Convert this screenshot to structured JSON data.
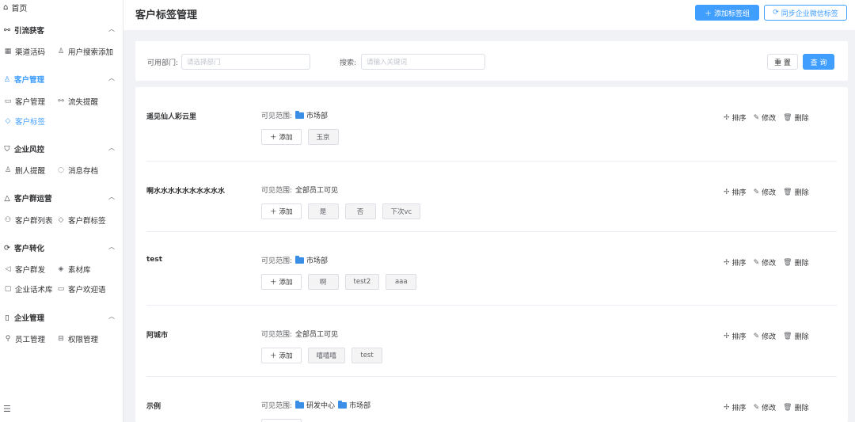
{
  "sidebar": {
    "home": {
      "icon": "home-icon",
      "label": "首页"
    },
    "groups": [
      {
        "icon": "share-icon",
        "title": "引流获客",
        "items": [
          {
            "icon": "qrcode-icon",
            "label": "渠道活码"
          },
          {
            "icon": "user-search-icon",
            "label": "用户搜索添加"
          }
        ]
      },
      {
        "icon": "user-icon",
        "title": "客户管理",
        "active": true,
        "items": [
          {
            "icon": "id-card-icon",
            "label": "客户管理"
          },
          {
            "icon": "user-lost-icon",
            "label": "流失提醒"
          },
          {
            "icon": "tag-icon",
            "label": "客户标签",
            "active": true
          }
        ]
      },
      {
        "icon": "shield-icon",
        "title": "企业风控",
        "items": [
          {
            "icon": "user-delete-icon",
            "label": "删人提醒"
          },
          {
            "icon": "message-icon",
            "label": "消息存档"
          }
        ]
      },
      {
        "icon": "group-icon",
        "title": "客户群运营",
        "items": [
          {
            "icon": "group-list-icon",
            "label": "客户群列表"
          },
          {
            "icon": "tag-icon",
            "label": "客户群标签"
          }
        ]
      },
      {
        "icon": "convert-icon",
        "title": "客户转化",
        "items": [
          {
            "icon": "send-icon",
            "label": "客户群发"
          },
          {
            "icon": "layers-icon",
            "label": "素材库"
          },
          {
            "icon": "chat-icon",
            "label": "企业话术库"
          },
          {
            "icon": "welcome-icon",
            "label": "客户欢迎语"
          }
        ]
      },
      {
        "icon": "building-icon",
        "title": "企业管理",
        "items": [
          {
            "icon": "staff-icon",
            "label": "员工管理"
          },
          {
            "icon": "permission-icon",
            "label": "权限管理"
          }
        ]
      }
    ],
    "fold_icon": "menu-fold-icon"
  },
  "header": {
    "title": "客户标签管理",
    "add_group_label": "添加标签组",
    "sync_label": "同步企业微信标签"
  },
  "filter": {
    "dept_label": "可用部门:",
    "dept_placeholder": "请选择部门",
    "search_label": "搜索:",
    "search_placeholder": "请输入关键词",
    "reset_label": "重 置",
    "query_label": "查 询"
  },
  "scope_label": "可见范围:",
  "add_tag_label": "添加",
  "action_labels": {
    "sort": "排序",
    "edit": "修改",
    "delete": "删除"
  },
  "groups": [
    {
      "name": "遥见仙人彩云里",
      "scope": {
        "type": "dept",
        "values": [
          "市场部"
        ]
      },
      "tags": [
        "玉京"
      ]
    },
    {
      "name": "啊水水水水水水水水水水",
      "scope": {
        "type": "all",
        "text": "全部员工可见"
      },
      "tags": [
        "是",
        "否",
        "下次vc"
      ]
    },
    {
      "name": "test",
      "scope": {
        "type": "dept",
        "values": [
          "市场部"
        ]
      },
      "tags": [
        "啊",
        "test2",
        "aaa"
      ]
    },
    {
      "name": "阿城市",
      "scope": {
        "type": "all",
        "text": "全部员工可见"
      },
      "tags": [
        "嘻嘻嘻",
        "test"
      ]
    },
    {
      "name": "示例",
      "scope": {
        "type": "dept",
        "values": [
          "研发中心",
          "市场部"
        ]
      },
      "tags": []
    }
  ],
  "colors": {
    "primary": "#409eff",
    "background": "#f0f2f5",
    "folder": "#3a8ee6"
  }
}
